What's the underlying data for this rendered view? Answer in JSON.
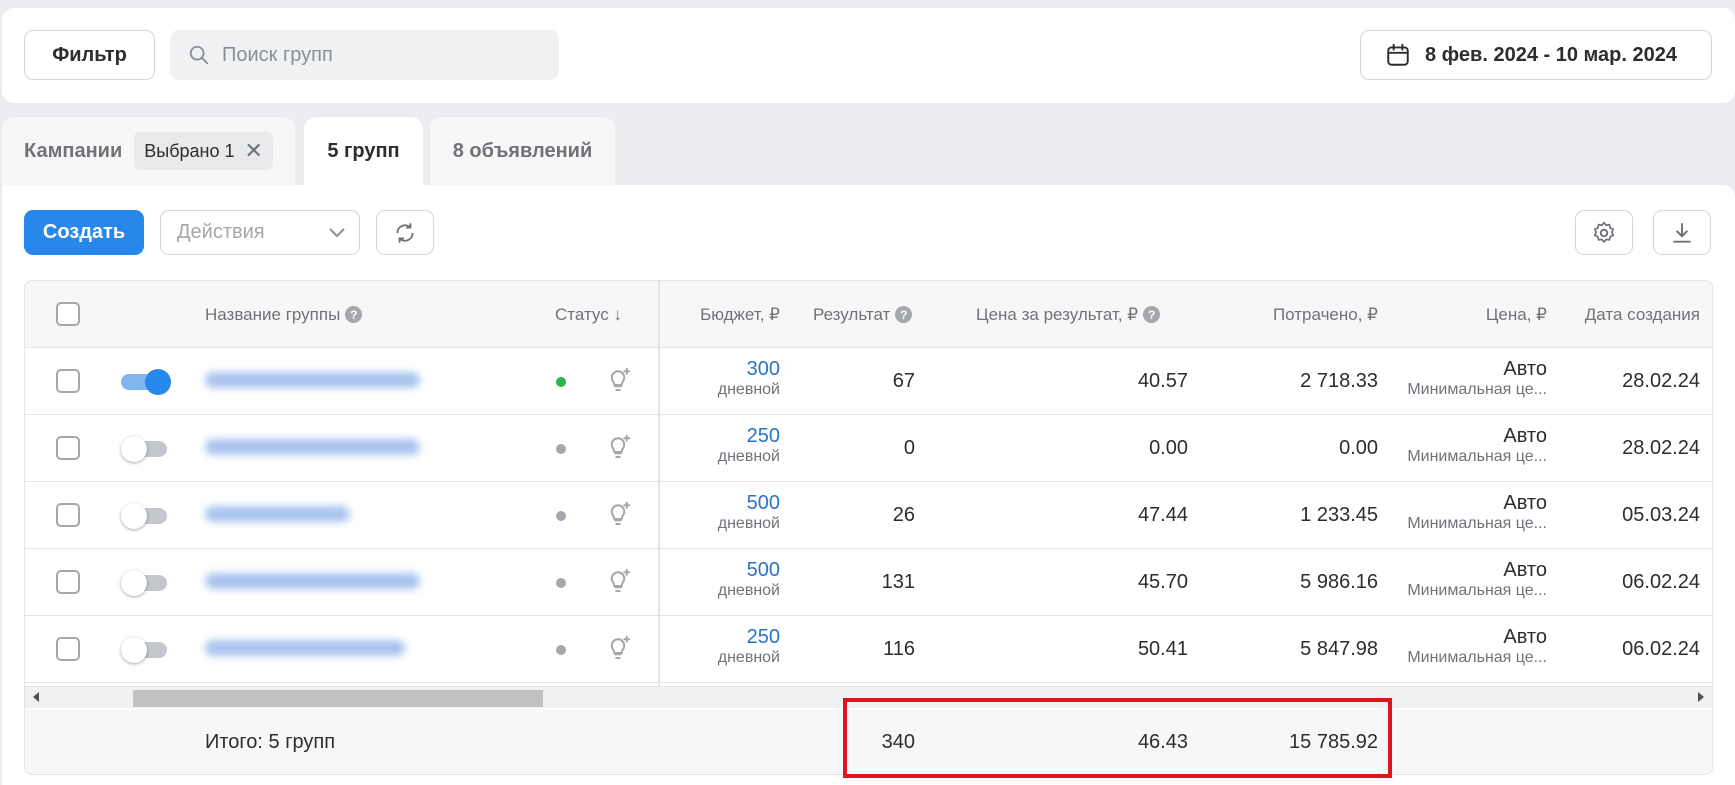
{
  "toolbar": {
    "filter_label": "Фильтр",
    "search_placeholder": "Поиск групп",
    "date_range": "8 фев. 2024 - 10 мар. 2024"
  },
  "tabs": {
    "campaigns_label": "Кампании",
    "campaigns_chip": "Выбрано 1",
    "groups_label": "5 групп",
    "ads_label": "8 объявлений"
  },
  "actions": {
    "create_label": "Создать",
    "actions_placeholder": "Действия"
  },
  "table": {
    "headers": {
      "name": "Название группы",
      "status": "Статус ↓",
      "budget": "Бюджет, ₽",
      "result": "Результат",
      "cost_per_result": "Цена за результат, ₽",
      "spent": "Потрачено, ₽",
      "price": "Цена, ₽",
      "created": "Дата создания"
    },
    "rows": [
      {
        "enabled": true,
        "status_color": "#2ab44a",
        "budget": "300",
        "budget_period": "дневной",
        "result": "67",
        "cost_per_result": "40.57",
        "spent": "2 718.33",
        "price": "Авто",
        "price_sub": "Минимальная це...",
        "created": "28.02.24"
      },
      {
        "enabled": false,
        "status_color": "#a4a7ab",
        "budget": "250",
        "budget_period": "дневной",
        "result": "0",
        "cost_per_result": "0.00",
        "spent": "0.00",
        "price": "Авто",
        "price_sub": "Минимальная це...",
        "created": "28.02.24"
      },
      {
        "enabled": false,
        "status_color": "#a4a7ab",
        "budget": "500",
        "budget_period": "дневной",
        "result": "26",
        "cost_per_result": "47.44",
        "spent": "1 233.45",
        "price": "Авто",
        "price_sub": "Минимальная це...",
        "created": "05.03.24"
      },
      {
        "enabled": false,
        "status_color": "#a4a7ab",
        "budget": "500",
        "budget_period": "дневной",
        "result": "131",
        "cost_per_result": "45.70",
        "spent": "5 986.16",
        "price": "Авто",
        "price_sub": "Минимальная це...",
        "created": "06.02.24"
      },
      {
        "enabled": false,
        "status_color": "#a4a7ab",
        "budget": "250",
        "budget_period": "дневной",
        "result": "116",
        "cost_per_result": "50.41",
        "spent": "5 847.98",
        "price": "Авто",
        "price_sub": "Минимальная це...",
        "created": "06.02.24"
      }
    ],
    "totals": {
      "label": "Итого: 5 групп",
      "result": "340",
      "cost_per_result": "46.43",
      "spent": "15 785.92"
    }
  },
  "colors": {
    "accent": "#2688eb",
    "highlight": "#e0141e"
  }
}
